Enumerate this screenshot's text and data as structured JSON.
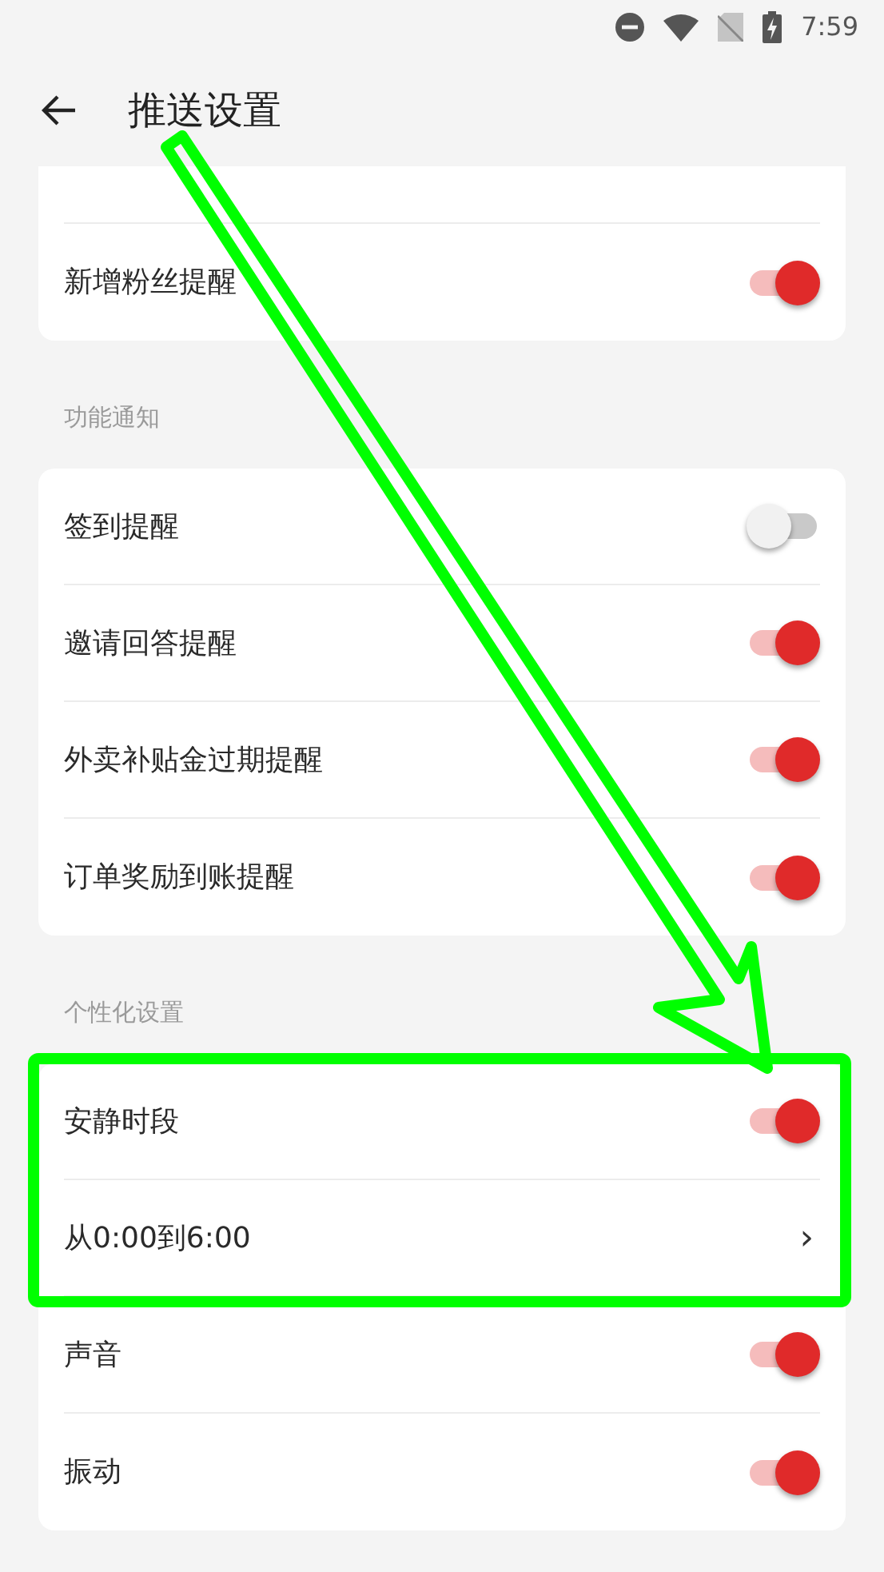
{
  "status_bar": {
    "time": "7:59"
  },
  "header": {
    "title": "推送设置"
  },
  "sections": [
    {
      "rows": [
        {
          "kind": "toggle",
          "label": "新增粉丝提醒",
          "on": true
        }
      ]
    },
    {
      "label": "功能通知",
      "rows": [
        {
          "kind": "toggle",
          "label": "签到提醒",
          "on": false
        },
        {
          "kind": "toggle",
          "label": "邀请回答提醒",
          "on": true
        },
        {
          "kind": "toggle",
          "label": "外卖补贴金过期提醒",
          "on": true
        },
        {
          "kind": "toggle",
          "label": "订单奖励到账提醒",
          "on": true
        }
      ]
    },
    {
      "label": "个性化设置",
      "rows": [
        {
          "kind": "toggle",
          "label": "安静时段",
          "on": true
        },
        {
          "kind": "link",
          "label": "从0:00到6:00",
          "arrow": "›"
        },
        {
          "kind": "toggle",
          "label": "声音",
          "on": true
        },
        {
          "kind": "toggle",
          "label": "振动",
          "on": true
        }
      ]
    }
  ]
}
